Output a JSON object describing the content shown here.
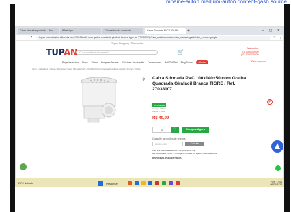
{
  "caption": "mpaine-auton medium-auton content-gasb source",
  "browser": {
    "tabs": [
      {
        "label": "Caixa sifonada quadrada - Pes"
      },
      {
        "label": "WhatsApp"
      },
      {
        "label": "Caixa sifonada quadrada"
      },
      {
        "label": "Caixa Sifonada PVC 100x140"
      }
    ],
    "new_tab": "+",
    "window_controls": "–  ▢  ✕",
    "url": "tupan.com.br/caixa-sifonada-pvc-100x140x50-com-grelha-quadrada-girafacil-branca-tigre-ref-27038107/p?utm_medium=auton&utm_content=gasb&utm_source=google"
  },
  "site": {
    "top_info": "Tupan Shopping  ·  Televendas",
    "logo_main": "TUP",
    "logo_accent": "AN",
    "search_placeholder": "O que você está buscando?",
    "contact": [
      "Televendas",
      "(11) 3000-0000",
      "(11) 93000-0000"
    ],
    "menu": [
      "Departamentos",
      "Pisos",
      "Tintas",
      "Louças e Metais",
      "Elétrica e Iluminação",
      "Ferramentas",
      "Self-TUPAN",
      "Blog Tupan",
      "Ofertas"
    ],
    "phone_cta": "Fale conosco"
  },
  "breadcrumb": "Início / Hidráulica / Caixas Sifonadas / Caixa Sifonada PVC 100x140x50 com Grelha Quadrada Girafácil Branca TIGRE",
  "product": {
    "title": "Caixa Sifonada PVC 100x140x50 com Grelha Quadrada Giráfácil Branca TIGRE / Ref. 27038107",
    "stock_badge": "Em Estoque",
    "meta": [
      "Código: 00000",
      "Marca: TIGRE"
    ],
    "price": "R$ 49,99",
    "quantity": "1",
    "add_symbol": "🛒",
    "buy_label": "Comprar Agora",
    "shipping_label": "Consulte as opções de entrega",
    "cep_placeholder": "00000-000",
    "calc_label": "Calcular",
    "cep_info": [
      "CEP ENTREGA ESPECIAL - APHASNOS - R$",
      "RETIRADA EM LOJA - Pronto para retirada em loja em até 2 dias úteis"
    ],
    "availability": "DISPONÍVEL PARA ENTREGA"
  },
  "taskbar": {
    "weather": "26°C Nublado",
    "search": "Pesquisar",
    "tray": [
      "POR",
      "17:04",
      "05/04/2024"
    ],
    "app_colors": [
      "#e05a2a",
      "#1f6fd6",
      "#f0b429",
      "#2f63d6",
      "#c0392b",
      "#27a844",
      "#6a4bd6",
      "#e23b2f"
    ]
  }
}
